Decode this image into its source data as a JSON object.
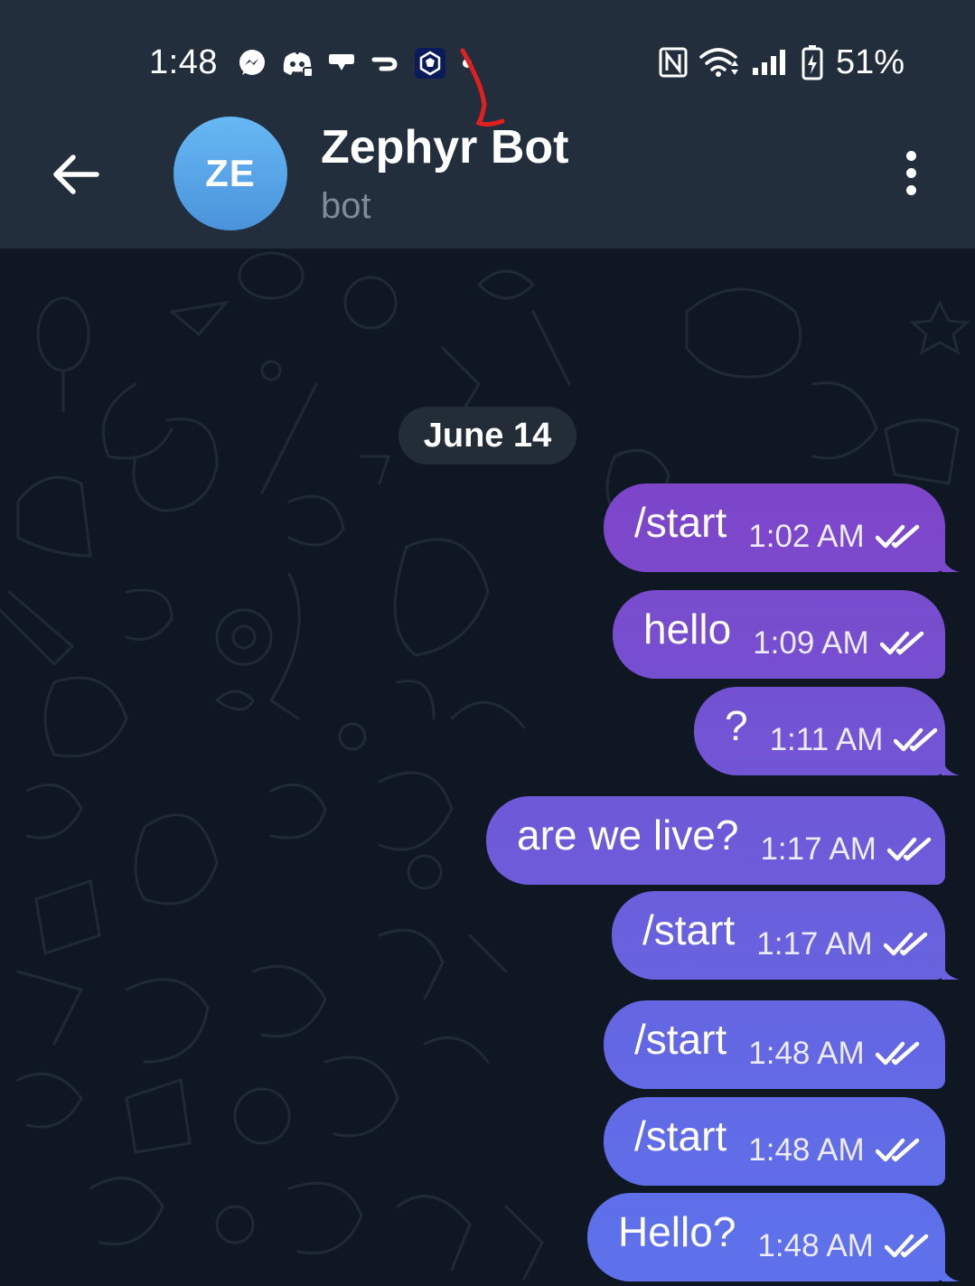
{
  "status_bar": {
    "time": "1:48",
    "battery": "51%",
    "left_icons": [
      "messenger-icon",
      "discord-icon",
      "chat-icon",
      "link-icon",
      "crypto-app-icon",
      "dot-icon"
    ],
    "right_icons": [
      "nfc-icon",
      "wifi-icon",
      "signal-icon",
      "battery-icon"
    ]
  },
  "header": {
    "avatar_initials": "ZE",
    "title": "Zephyr Bot",
    "subtitle": "bot"
  },
  "chat": {
    "date_separator": "June 14",
    "messages": [
      {
        "text": "/start",
        "time": "1:02 AM",
        "status": "read"
      },
      {
        "text": "hello",
        "time": "1:09 AM",
        "status": "read"
      },
      {
        "text": "?",
        "time": "1:11 AM",
        "status": "read"
      },
      {
        "text": "are we live?",
        "time": "1:17 AM",
        "status": "read"
      },
      {
        "text": "/start",
        "time": "1:17 AM",
        "status": "read"
      },
      {
        "text": "/start",
        "time": "1:48 AM",
        "status": "read"
      },
      {
        "text": "/start",
        "time": "1:48 AM",
        "status": "read"
      },
      {
        "text": "Hello?",
        "time": "1:48 AM",
        "status": "read"
      }
    ]
  },
  "colors": {
    "header_bg": "#232e3c",
    "chat_bg": "#0f1722",
    "bubble_gradient_top": "#7b47c9",
    "bubble_gradient_bottom": "#6470ee",
    "subtitle": "#7f8b99"
  }
}
